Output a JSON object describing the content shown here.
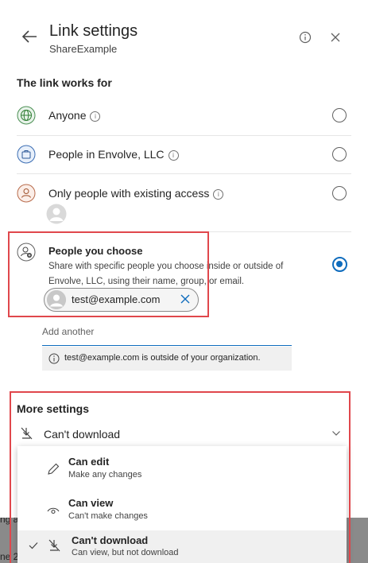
{
  "background": {
    "snippet_1": "ng a",
    "snippet_2": "ne 2"
  },
  "header": {
    "title": "Link settings",
    "subtitle": "ShareExample",
    "back_icon": "arrow-left-icon",
    "info_icon": "info-icon",
    "close_icon": "close-icon"
  },
  "link_works_for": {
    "heading": "The link works for",
    "options": [
      {
        "label": "Anyone",
        "icon": "globe-icon",
        "selected": false
      },
      {
        "label": "People in Envolve, LLC",
        "icon": "building-icon",
        "selected": false
      },
      {
        "label": "Only people with existing access",
        "icon": "person-icon",
        "selected": false
      },
      {
        "label": "People you choose",
        "icon": "person-add-icon",
        "selected": true,
        "description": "Share with specific people you choose inside or outside of Envolve, LLC, using their name, group, or email."
      }
    ]
  },
  "recipient_chip": {
    "email": "test@example.com"
  },
  "add_another": {
    "label": "Add another",
    "warning": "test@example.com is outside of your organization."
  },
  "more_settings": {
    "heading": "More settings",
    "dropdown_value": "Can't download",
    "menu": [
      {
        "label": "Can edit",
        "sub": "Make any changes",
        "icon": "pencil-icon",
        "selected": false
      },
      {
        "label": "Can view",
        "sub": "Can't make changes",
        "icon": "eye-icon",
        "selected": false
      },
      {
        "label": "Can't download",
        "sub": "Can view, but not download",
        "icon": "no-download-icon",
        "selected": true
      }
    ]
  },
  "colors": {
    "accent": "#0f6cbd",
    "annotation_red": "#e0474c"
  }
}
